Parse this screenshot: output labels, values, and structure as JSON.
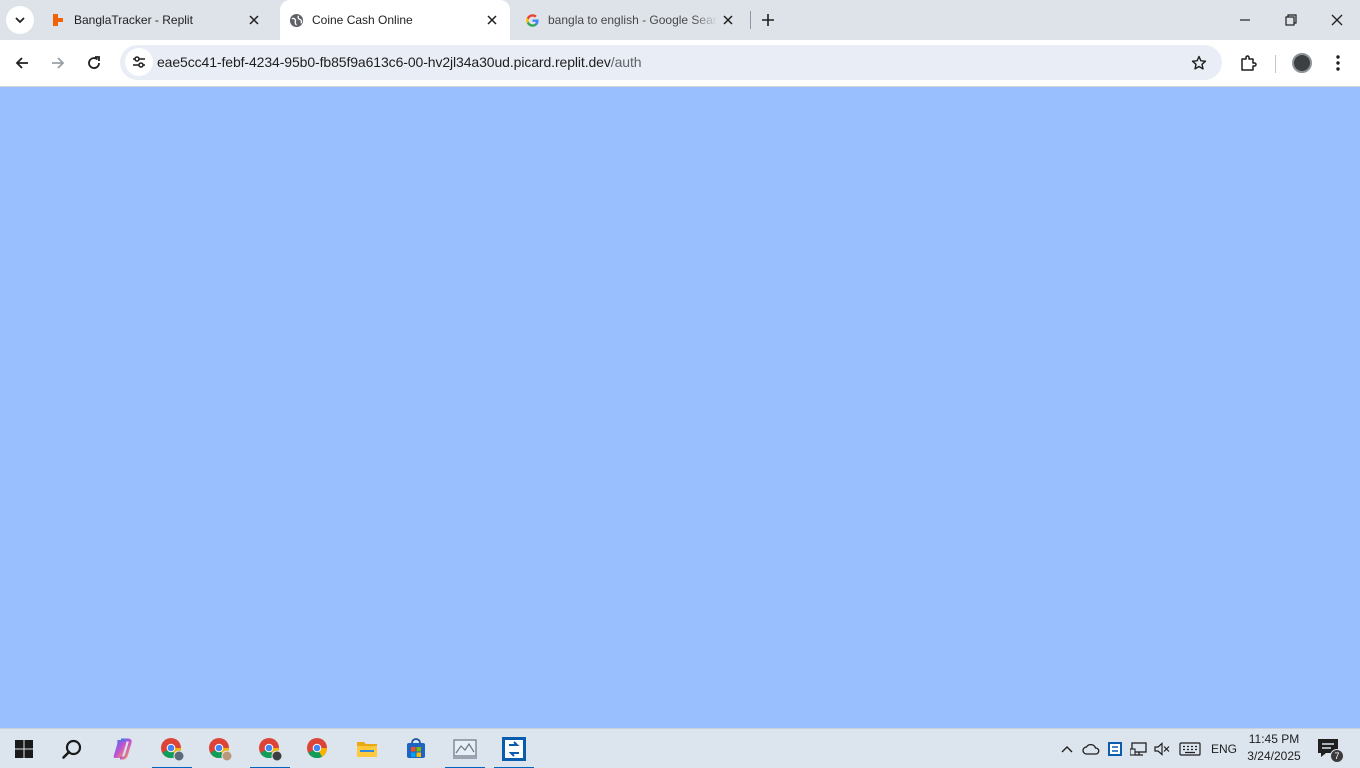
{
  "browser": {
    "tabs": [
      {
        "title": "BanglaTracker - Replit",
        "favicon": "replit-icon",
        "active": false
      },
      {
        "title": "Coine Cash Online",
        "favicon": "globe-icon",
        "active": true
      },
      {
        "title": "bangla to english - Google Search",
        "favicon": "google-icon",
        "active": false
      }
    ],
    "address_bar": {
      "host": "eae5cc41-febf-4234-95b0-fb85f9a613c6-00-hv2jl34a30ud.picard.replit.dev",
      "path": "/auth"
    }
  },
  "page": {
    "background_color": "#99bfff"
  },
  "taskbar": {
    "apps": [
      "windows-start-icon",
      "search-icon",
      "copilot-icon",
      "chrome-profile-icon",
      "chrome-icon",
      "chrome-profile-icon",
      "chrome-icon",
      "file-explorer-icon",
      "microsoft-store-icon",
      "app-icon",
      "remote-desktop-icon"
    ],
    "language": "ENG",
    "time": "11:45 PM",
    "date": "3/24/2025",
    "notification_count": "7"
  },
  "colors": {
    "accent": "#0067c0",
    "tab_strip": "#dee3ea",
    "omnibox": "#e9eef6"
  }
}
